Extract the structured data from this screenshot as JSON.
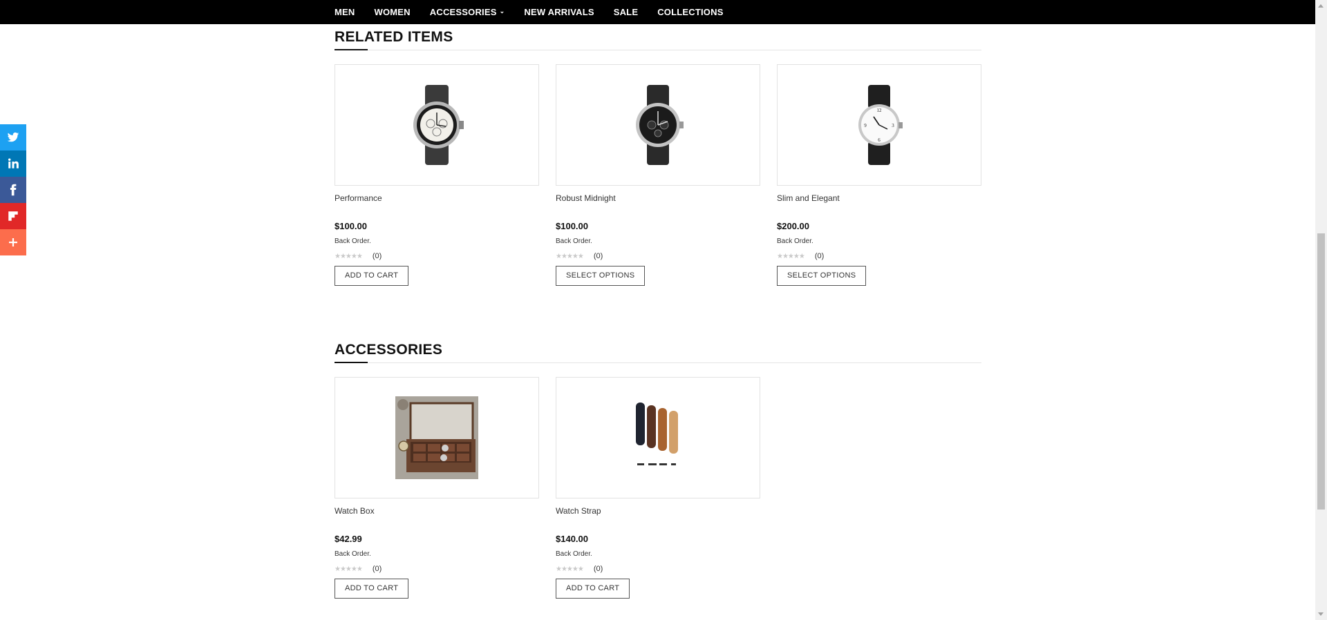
{
  "nav": {
    "items": [
      {
        "label": "MEN"
      },
      {
        "label": "WOMEN"
      },
      {
        "label": "ACCESSORIES",
        "has_dropdown": true
      },
      {
        "label": "NEW ARRIVALS"
      },
      {
        "label": "SALE"
      },
      {
        "label": "COLLECTIONS"
      }
    ]
  },
  "social": {
    "items": [
      {
        "icon": "twitter-icon",
        "color": "#1da1f2"
      },
      {
        "icon": "linkedin-icon",
        "color": "#0077b5"
      },
      {
        "icon": "facebook-icon",
        "color": "#3b5998"
      },
      {
        "icon": "flipboard-icon",
        "color": "#e12828"
      },
      {
        "icon": "plus-icon",
        "color": "#fc6d4c"
      }
    ]
  },
  "related": {
    "title": "RELATED ITEMS",
    "products": [
      {
        "name": "Performance",
        "price": "$100.00",
        "stock": "Back Order.",
        "review_count": "(0)",
        "button": "ADD TO CART",
        "image_icon": "chronograph-watch-icon"
      },
      {
        "name": "Robust Midnight",
        "price": "$100.00",
        "stock": "Back Order.",
        "review_count": "(0)",
        "button": "SELECT OPTIONS",
        "image_icon": "black-dial-watch-icon"
      },
      {
        "name": "Slim and Elegant",
        "price": "$200.00",
        "stock": "Back Order.",
        "review_count": "(0)",
        "button": "SELECT OPTIONS",
        "image_icon": "white-dial-watch-icon"
      }
    ]
  },
  "accessories": {
    "title": "ACCESSORIES",
    "products": [
      {
        "name": "Watch Box",
        "price": "$42.99",
        "stock": "Back Order.",
        "review_count": "(0)",
        "button": "ADD TO CART",
        "image_icon": "watch-box-icon"
      },
      {
        "name": "Watch Strap",
        "price": "$140.00",
        "stock": "Back Order.",
        "review_count": "(0)",
        "button": "ADD TO CART",
        "image_icon": "watch-straps-icon"
      }
    ]
  },
  "rating_stars": "★★★★★"
}
